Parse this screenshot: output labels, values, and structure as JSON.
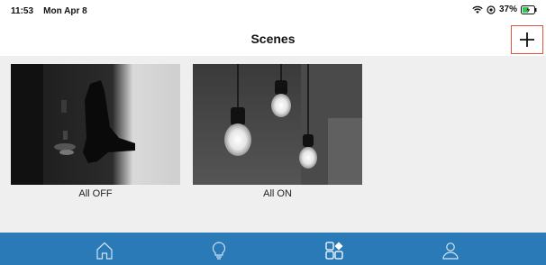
{
  "status_bar": {
    "time": "11:53",
    "date": "Mon Apr 8",
    "battery": "37%"
  },
  "nav": {
    "title": "Scenes",
    "add_icon": "plus-icon"
  },
  "scenes": [
    {
      "label": "All OFF",
      "image": "dark-lamp-silhouette"
    },
    {
      "label": "All ON",
      "image": "hanging-light-bulbs"
    }
  ],
  "tab_bar": {
    "tabs": [
      {
        "icon": "home-icon"
      },
      {
        "icon": "lightbulb-icon"
      },
      {
        "icon": "scenes-grid-icon",
        "selected": true
      },
      {
        "icon": "user-icon"
      }
    ]
  },
  "colors": {
    "tab_bar_bg": "#2a7ab8",
    "content_bg": "#efefef",
    "highlight": "#e0553c"
  }
}
